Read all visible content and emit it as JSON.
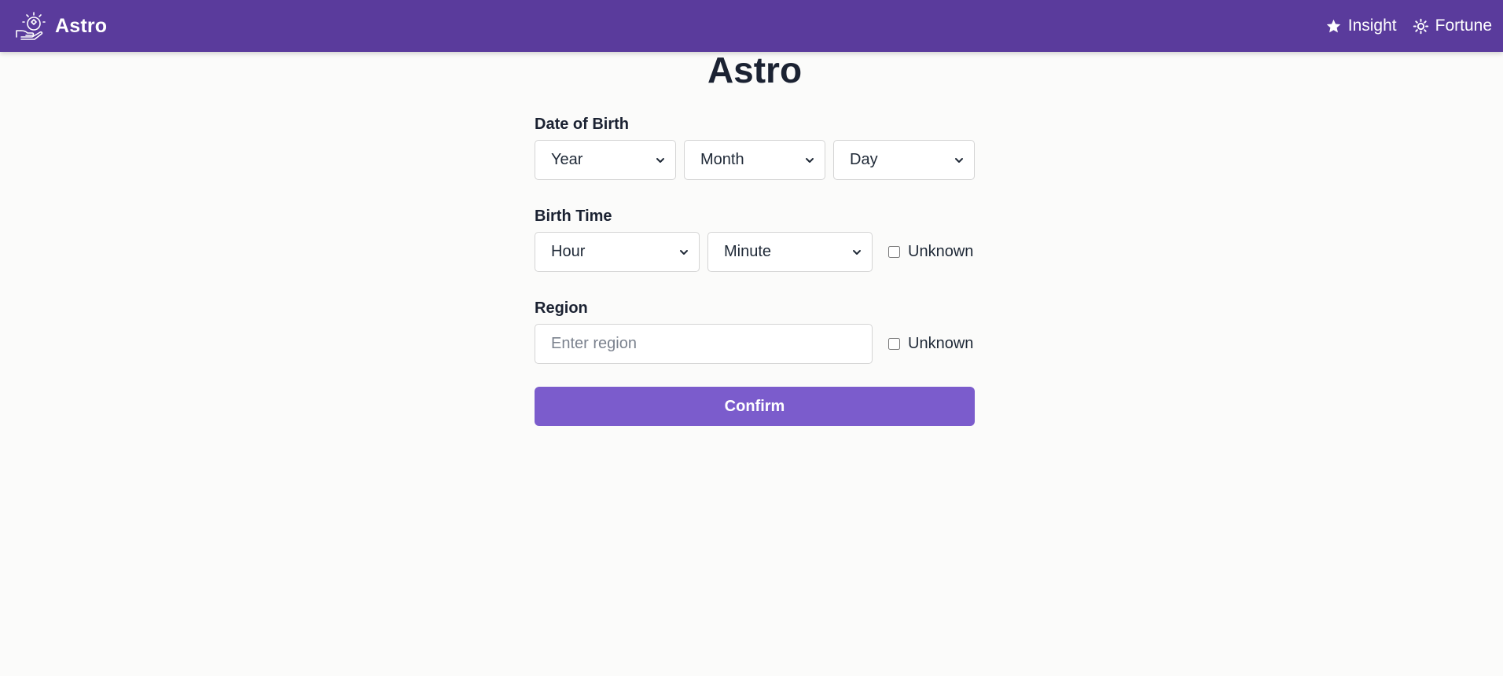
{
  "nav": {
    "brand": "Astro",
    "links": [
      {
        "label": "Insight",
        "icon": "star-icon"
      },
      {
        "label": "Fortune",
        "icon": "sun-icon"
      }
    ]
  },
  "page": {
    "title": "Astro"
  },
  "form": {
    "dob": {
      "label": "Date of Birth",
      "year": "Year",
      "month": "Month",
      "day": "Day"
    },
    "time": {
      "label": "Birth Time",
      "hour": "Hour",
      "minute": "Minute",
      "unknown": "Unknown"
    },
    "region": {
      "label": "Region",
      "placeholder": "Enter region",
      "value": "",
      "unknown": "Unknown"
    },
    "confirm": "Confirm"
  },
  "colors": {
    "nav_bg": "#5a3b9c",
    "button_bg": "#7b5ccc",
    "page_bg": "#fbfbfa"
  }
}
